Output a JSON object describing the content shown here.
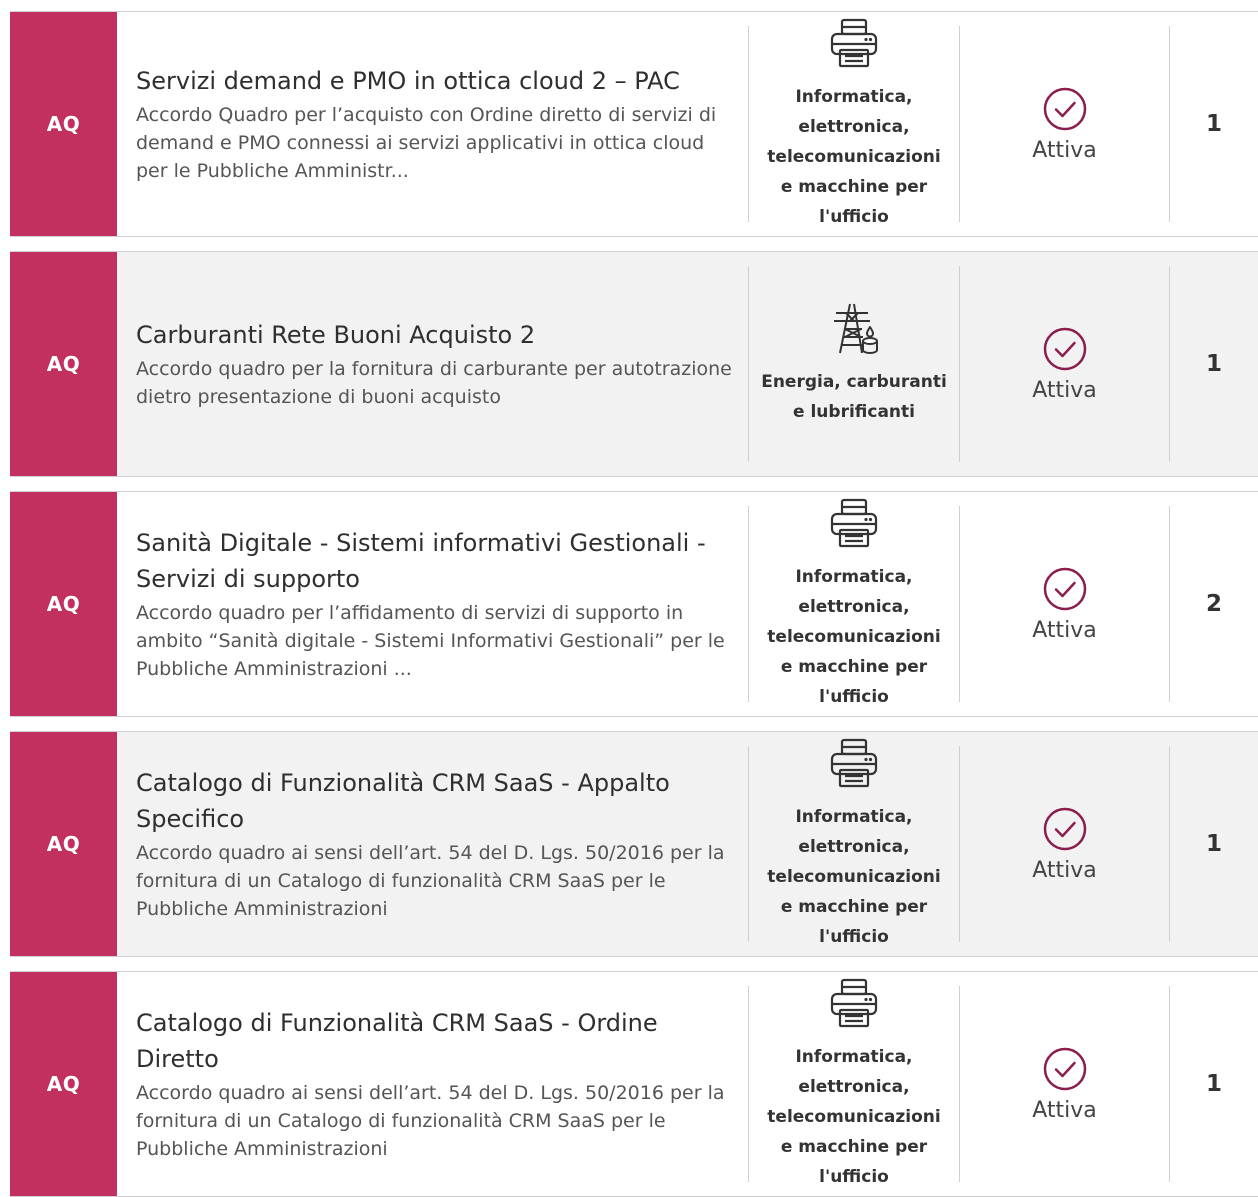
{
  "colors": {
    "type_badge": "#c2305f",
    "status_icon": "#8a1f4d",
    "row_alt_bg": "#f2f2f2"
  },
  "rows": [
    {
      "type": "AQ",
      "title": "Servizi demand e PMO in ottica cloud 2 – PAC",
      "description": "Accordo Quadro per l’acquisto con Ordine diretto di servizi di demand e PMO connessi ai servizi applicativi in ottica cloud per le Pubbliche Amministr...",
      "category_icon": "printer-icon",
      "category": "Informatica, elettronica, telecomunicazioni e macchine per l'ufficio",
      "status_icon": "check-circle-icon",
      "status": "Attiva",
      "count": "1"
    },
    {
      "type": "AQ",
      "title": "Carburanti Rete Buoni Acquisto 2",
      "description": "Accordo quadro per la fornitura di carburante per autotrazione dietro presentazione di buoni acquisto",
      "category_icon": "power-pylon-icon",
      "category": "Energia, carburanti e lubrificanti",
      "status_icon": "check-circle-icon",
      "status": "Attiva",
      "count": "1"
    },
    {
      "type": "AQ",
      "title": "Sanità Digitale - Sistemi informativi Gestionali - Servizi di supporto",
      "description": "Accordo quadro per l’affidamento di servizi di supporto in ambito “Sanità digitale - Sistemi Informativi Gestionali” per le Pubbliche Amministrazioni ...",
      "category_icon": "printer-icon",
      "category": "Informatica, elettronica, telecomunicazioni e macchine per l'ufficio",
      "status_icon": "check-circle-icon",
      "status": "Attiva",
      "count": "2"
    },
    {
      "type": "AQ",
      "title": "Catalogo di Funzionalità CRM SaaS - Appalto Specifico",
      "description": "Accordo quadro ai sensi dell’art. 54 del D. Lgs. 50/2016 per la fornitura di un Catalogo di funzionalità CRM SaaS per le Pubbliche Amministrazioni",
      "category_icon": "printer-icon",
      "category": "Informatica, elettronica, telecomunicazioni e macchine per l'ufficio",
      "status_icon": "check-circle-icon",
      "status": "Attiva",
      "count": "1"
    },
    {
      "type": "AQ",
      "title": "Catalogo di Funzionalità CRM SaaS - Ordine Diretto",
      "description": "Accordo quadro ai sensi dell’art. 54 del D. Lgs. 50/2016 per la fornitura di un Catalogo di funzionalità CRM SaaS per le Pubbliche Amministrazioni",
      "category_icon": "printer-icon",
      "category": "Informatica, elettronica, telecomunicazioni e macchine per l'ufficio",
      "status_icon": "check-circle-icon",
      "status": "Attiva",
      "count": "1"
    }
  ]
}
